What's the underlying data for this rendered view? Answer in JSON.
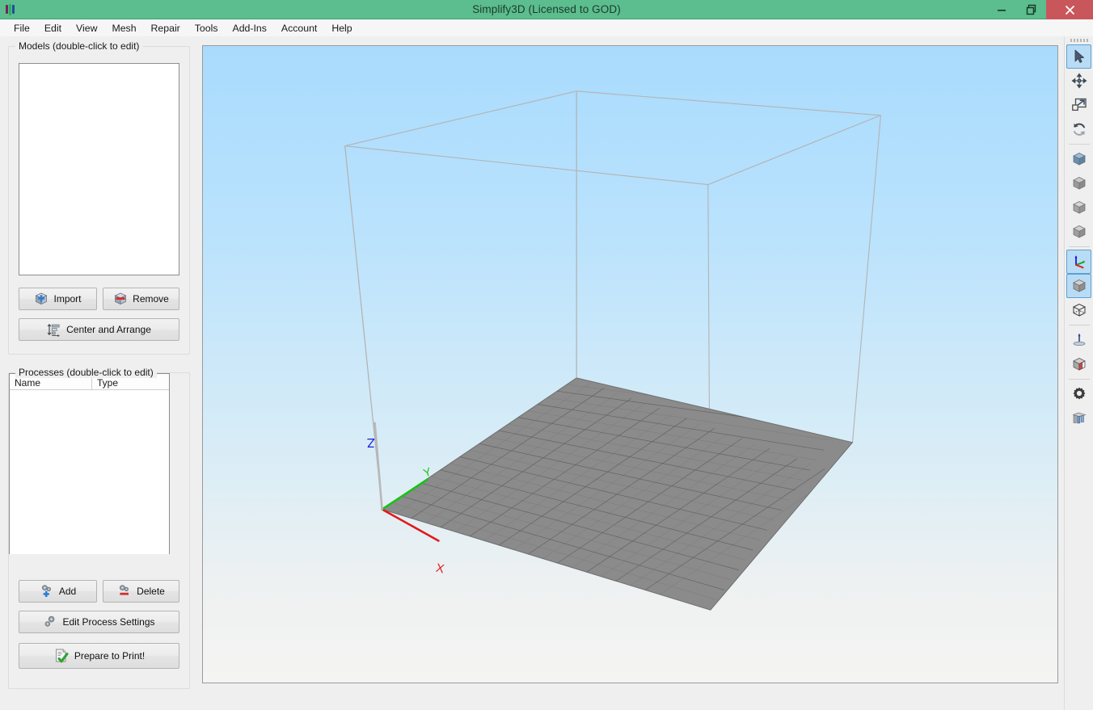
{
  "window": {
    "title": "Simplify3D (Licensed to GOD)",
    "logo_icon": "simplify3d-logo-icon",
    "accent_color": "#5cbd8e",
    "close_color": "#c9565b",
    "minimize_label": "–",
    "maximize_label": "❐",
    "close_label": "✕"
  },
  "menubar": {
    "items": [
      {
        "label": "File",
        "name": "menu-file"
      },
      {
        "label": "Edit",
        "name": "menu-edit"
      },
      {
        "label": "View",
        "name": "menu-view"
      },
      {
        "label": "Mesh",
        "name": "menu-mesh"
      },
      {
        "label": "Repair",
        "name": "menu-repair"
      },
      {
        "label": "Tools",
        "name": "menu-tools"
      },
      {
        "label": "Add-Ins",
        "name": "menu-addins"
      },
      {
        "label": "Account",
        "name": "menu-account"
      },
      {
        "label": "Help",
        "name": "menu-help"
      }
    ]
  },
  "models_panel": {
    "title": "Models (double-click to edit)",
    "list_items": [],
    "buttons": {
      "import": "Import",
      "remove": "Remove",
      "center_and_arrange": "Center and Arrange"
    }
  },
  "processes_panel": {
    "title": "Processes (double-click to edit)",
    "columns": [
      "Name",
      "Type"
    ],
    "rows": [],
    "buttons": {
      "add": "Add",
      "delete": "Delete",
      "edit_process_settings": "Edit Process Settings",
      "prepare_to_print": "Prepare to Print!"
    }
  },
  "viewport": {
    "axes": {
      "x_label": "X",
      "y_label": "Y",
      "z_label": "Z"
    },
    "axis_colors": {
      "x": "#e01b1b",
      "y": "#14c414",
      "z": "#1a1ae0"
    },
    "build_plate_color": "#8a8a8a",
    "grid_line_color": "#5e5e5e",
    "volume_edge_color": "#b0b0b0",
    "background_top": "#a9dbfd",
    "background_bottom": "#f4f4f2"
  },
  "toolbar": {
    "items": [
      {
        "name": "select-tool",
        "icon": "cursor-arrow-icon",
        "active": true
      },
      {
        "name": "move-tool",
        "icon": "move-arrows-icon",
        "active": false
      },
      {
        "name": "scale-tool",
        "icon": "scale-resize-icon",
        "active": false
      },
      {
        "name": "rotate-tool",
        "icon": "rotate-arrows-icon",
        "active": false
      },
      {
        "name": "view-isometric",
        "icon": "cube-blue-icon",
        "active": false
      },
      {
        "name": "view-front",
        "icon": "cube-gray-front-icon",
        "active": false
      },
      {
        "name": "view-top",
        "icon": "cube-gray-top-icon",
        "active": false
      },
      {
        "name": "view-side",
        "icon": "cube-gray-side-icon",
        "active": false
      },
      {
        "name": "show-axes",
        "icon": "xyz-axes-icon",
        "active": true
      },
      {
        "name": "solid-shading",
        "icon": "cube-solid-icon",
        "active": true
      },
      {
        "name": "wireframe-shading",
        "icon": "cube-wireframe-icon",
        "active": false
      },
      {
        "name": "show-nozzle",
        "icon": "nozzle-icon",
        "active": false
      },
      {
        "name": "cross-section",
        "icon": "cross-section-cube-icon",
        "active": false
      },
      {
        "name": "machine-settings",
        "icon": "gear-icon",
        "active": false
      },
      {
        "name": "extruder-settings",
        "icon": "extruders-icon",
        "active": false
      }
    ]
  }
}
